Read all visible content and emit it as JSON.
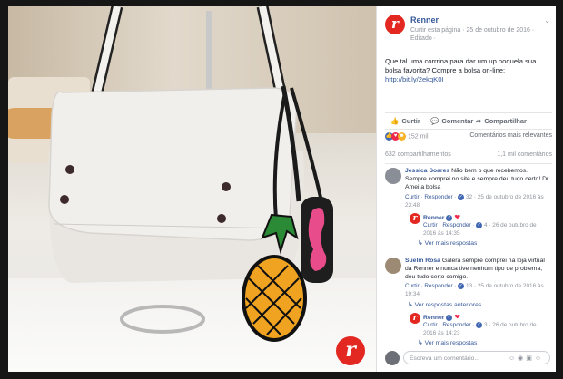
{
  "post": {
    "page_name": "Renner",
    "meta_line": "Curtir esta página · 25 de outubro de 2016 · Editado ·",
    "text": "Que tal uma corrrina para dar um up noquela sua bolsa favorita? Compre a bolsa on-line:",
    "link": "http://bit.ly/2ekqK0I",
    "reactions_count": "152 mil",
    "sort_label": "Comentários mais relevantes",
    "shares": "632 compartilhamentos",
    "comments_count": "1,1 mil comentários",
    "logo_letter": "r"
  },
  "actions": {
    "like": "Curtir",
    "comment": "Comentar",
    "share": "Compartilhar"
  },
  "comments": [
    {
      "author": "Jessica Soares",
      "text": "Não bem o que recebemos. Sempre comprei no site e sempre deu tudo certo! Dr. Amei a bolsa",
      "like": "Curtir",
      "reply": "Responder",
      "meta": "32 · 25 de outubro de 2016 às 23:48",
      "reply_author": "Renner",
      "reply_like": "Curtir",
      "reply_reply": "Responder",
      "reply_meta": "4 · 26 de outubro de 2016 às 14:35",
      "more": "Ver mais respostas"
    },
    {
      "author": "Suelin Rosa",
      "text": "Galera sempre comprei na loja virtual da Renner e nunca tive nenhum tipo de problema, deu tudo certo comigo.",
      "like": "Curtir",
      "reply": "Responder",
      "meta": "13 · 25 de outubro de 2016 às 19:34",
      "earlier": "Ver respostas anteriores",
      "reply_author": "Renner",
      "reply_like": "Curtir",
      "reply_reply": "Responder",
      "reply_meta": "3 · 26 de outubro de 2016 às 14:23",
      "more": "Ver mais respostas"
    }
  ],
  "composer": {
    "placeholder": "Escreva um comentário..."
  },
  "colors": {
    "brand": "#e32821",
    "link": "#365899",
    "like": "#4267b2",
    "love": "#f0284a"
  },
  "icons": [
    "chevron-down-icon",
    "like-icon",
    "comment-icon",
    "share-icon",
    "heart-icon",
    "verified-icon",
    "emoji-icon",
    "camera-icon",
    "gif-icon",
    "sticker-icon"
  ]
}
